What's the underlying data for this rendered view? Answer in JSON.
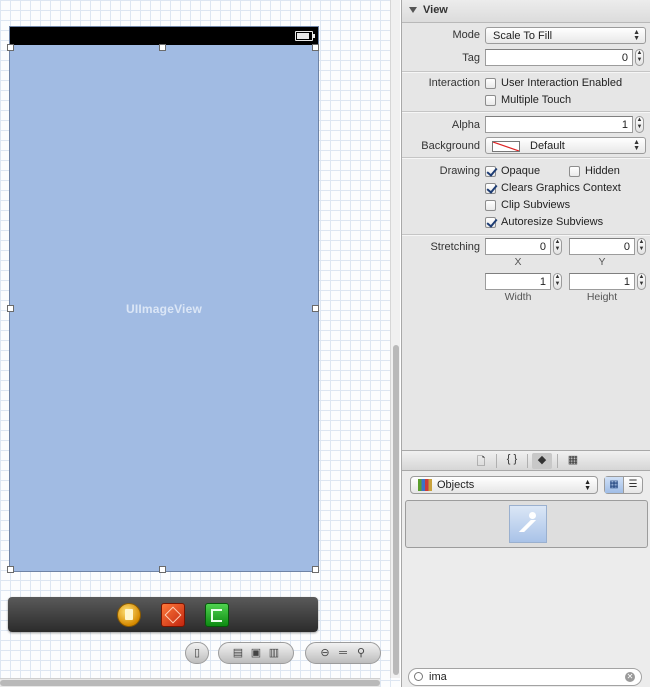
{
  "canvas": {
    "image_view_label": "UIImageView"
  },
  "zoom_controls": {
    "device_icon": "phone-icon",
    "layout_icons": [
      "layout-left-icon",
      "layout-fill-icon",
      "layout-right-icon"
    ],
    "zoom_icons": [
      "zoom-out-icon",
      "zoom-reset-icon",
      "zoom-in-icon"
    ]
  },
  "inspector": {
    "section_title": "View",
    "mode": {
      "label": "Mode",
      "value": "Scale To Fill"
    },
    "tag": {
      "label": "Tag",
      "value": "0"
    },
    "interaction": {
      "label": "Interaction",
      "user_interaction_enabled": {
        "label": "User Interaction Enabled",
        "checked": false
      },
      "multiple_touch": {
        "label": "Multiple Touch",
        "checked": false
      }
    },
    "alpha": {
      "label": "Alpha",
      "value": "1"
    },
    "background": {
      "label": "Background",
      "value": "Default"
    },
    "drawing": {
      "label": "Drawing",
      "opaque": {
        "label": "Opaque",
        "checked": true
      },
      "hidden": {
        "label": "Hidden",
        "checked": false
      },
      "clears_graphics_context": {
        "label": "Clears Graphics Context",
        "checked": true
      },
      "clip_subviews": {
        "label": "Clip Subviews",
        "checked": false
      },
      "autoresize_subviews": {
        "label": "Autoresize Subviews",
        "checked": true
      }
    },
    "stretching": {
      "label": "Stretching",
      "x": {
        "value": "0",
        "caption": "X"
      },
      "y": {
        "value": "0",
        "caption": "Y"
      },
      "width": {
        "value": "1",
        "caption": "Width"
      },
      "height": {
        "value": "1",
        "caption": "Height"
      }
    }
  },
  "library": {
    "tabs": [
      "file-template-icon",
      "code-snippet-icon",
      "object-cube-icon",
      "media-icon"
    ],
    "tab_glyphs": [
      "🗋",
      "{ }",
      "◆",
      "▦"
    ],
    "category": "Objects",
    "search": {
      "value": "ima"
    }
  }
}
